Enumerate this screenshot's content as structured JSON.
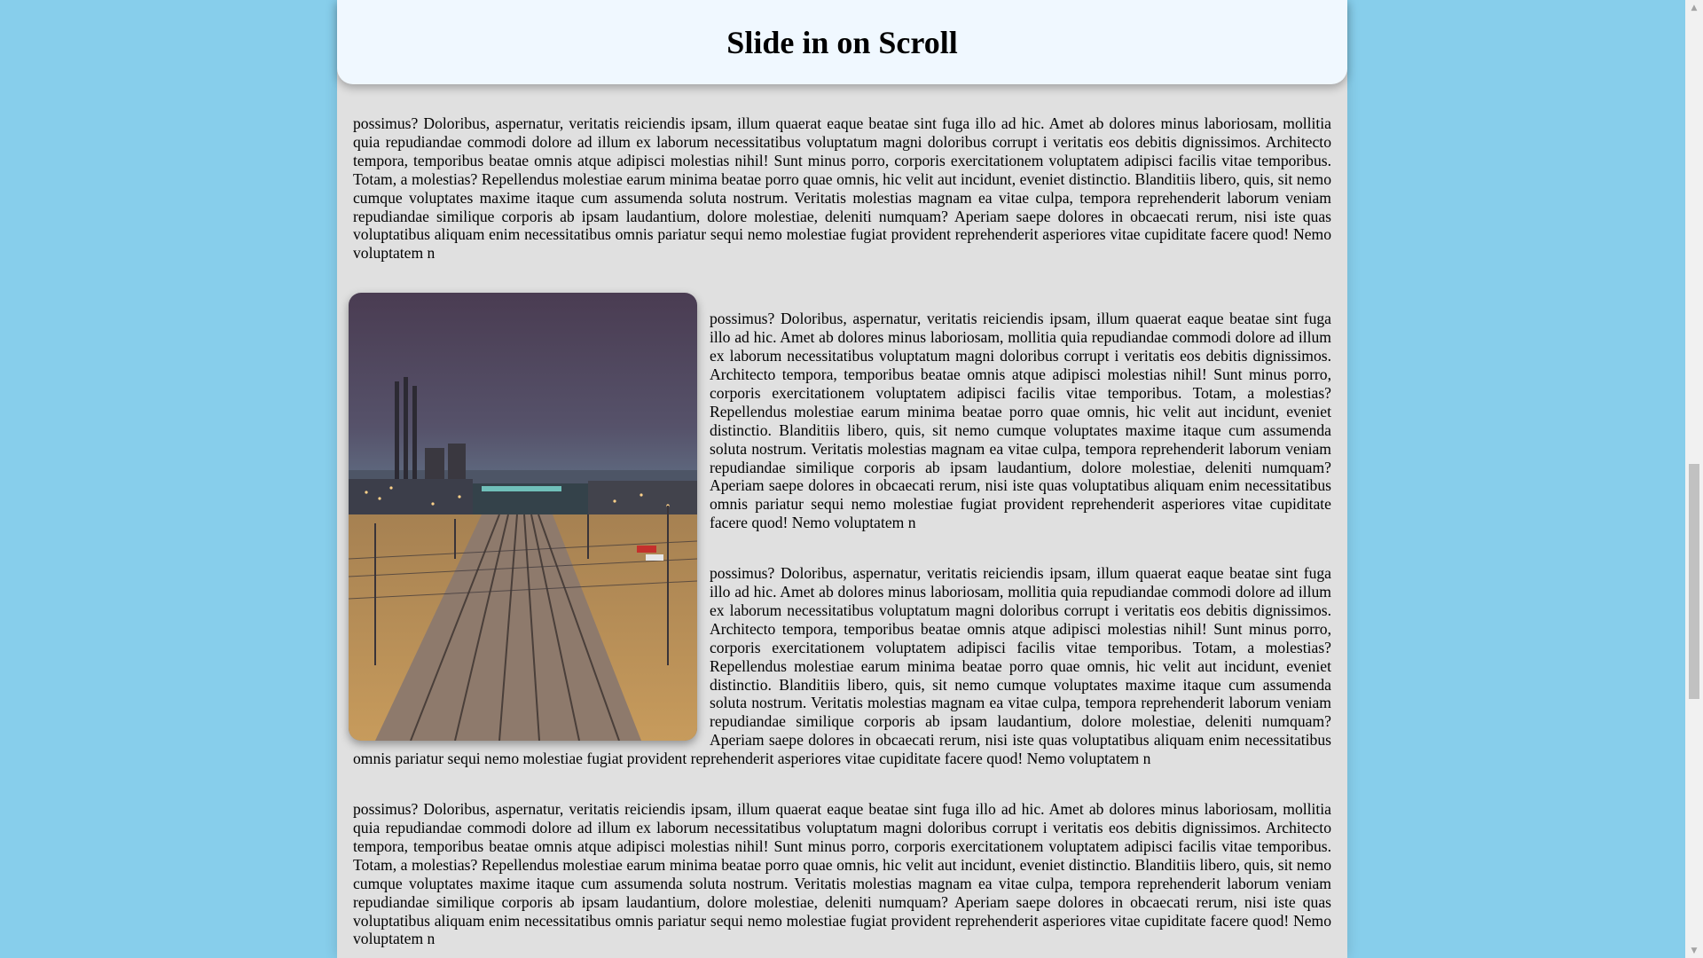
{
  "header": {
    "title": "Slide in on Scroll"
  },
  "content": {
    "paragraph": "possimus? Doloribus, aspernatur, veritatis reiciendis ipsam, illum quaerat eaque beatae sint fuga illo ad hic. Amet ab dolores minus laboriosam, mollitia quia repudiandae commodi dolore ad illum ex laborum necessitatibus voluptatum magni doloribus corrupt i veritatis eos debitis dignissimos. Architecto tempora, temporibus beatae omnis atque adipisci molestias nihil! Sunt minus porro, corporis exercitationem voluptatem adipisci facilis vitae temporibus. Totam, a molestias? Repellendus molestiae earum minima beatae porro quae omnis, hic velit aut incidunt, eveniet distinctio. Blanditiis libero, quis, sit nemo cumque voluptates maxime itaque cum assumenda soluta nostrum. Veritatis molestias magnam ea vitae culpa, tempora reprehenderit laborum veniam repudiandae similique corporis ab ipsam laudantium, dolore molestiae, deleniti numquam? Aperiam saepe dolores in obcaecati rerum, nisi iste quas voluptatibus aliquam enim necessitatibus omnis pariatur sequi nemo molestiae fugiat provident reprehenderit asperiores vitae cupiditate facere quod! Nemo voluptatem n"
  },
  "image": {
    "subject": "night-railway-tracks-image"
  },
  "colors": {
    "page_background": "#87ceeb",
    "content_background": "#e0e0e0",
    "header_background": "#f0f8ff"
  },
  "scrollbar": {
    "up_arrow": "▲",
    "down_arrow": "▼"
  }
}
